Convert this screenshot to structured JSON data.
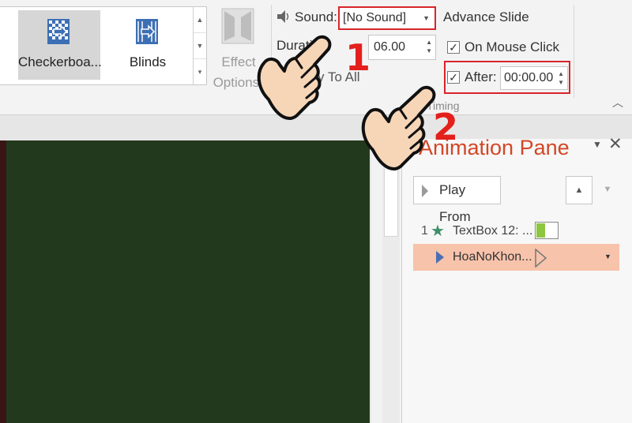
{
  "ribbon": {
    "gallery": {
      "items": [
        {
          "label": "Checkerboa...",
          "icon": "checkerboard-icon",
          "selected": true
        },
        {
          "label": "Blinds",
          "icon": "blinds-icon",
          "selected": false
        }
      ]
    },
    "effect_options": {
      "label": "Effect\nOptions",
      "icon": "effect-options-icon",
      "enabled": false
    },
    "timing": {
      "sound_label": "Sound:",
      "sound_value": "[No Sound]",
      "duration_label": "Duration:",
      "duration_value": "06.00",
      "apply_all_label": "Apply To All",
      "group_label": "Timing"
    },
    "advance": {
      "title": "Advance Slide",
      "on_mouse_click_label": "On Mouse Click",
      "on_mouse_click_checked": true,
      "after_label": "After:",
      "after_checked": true,
      "after_value": "00:00.00"
    }
  },
  "animation_pane": {
    "title": "Animation Pane",
    "play_from_label": "Play From",
    "items": [
      {
        "number": "1",
        "label": "TextBox 12: ..."
      },
      {
        "number": "",
        "label": "HoaNoKhon..."
      }
    ]
  },
  "annotations": {
    "step1": "1",
    "step2": "2",
    "highlight_color": "#d9242a"
  },
  "colors": {
    "slide_bg": "#23391d",
    "pane_title": "#d24726",
    "selected_row": "#f7c3ab"
  }
}
